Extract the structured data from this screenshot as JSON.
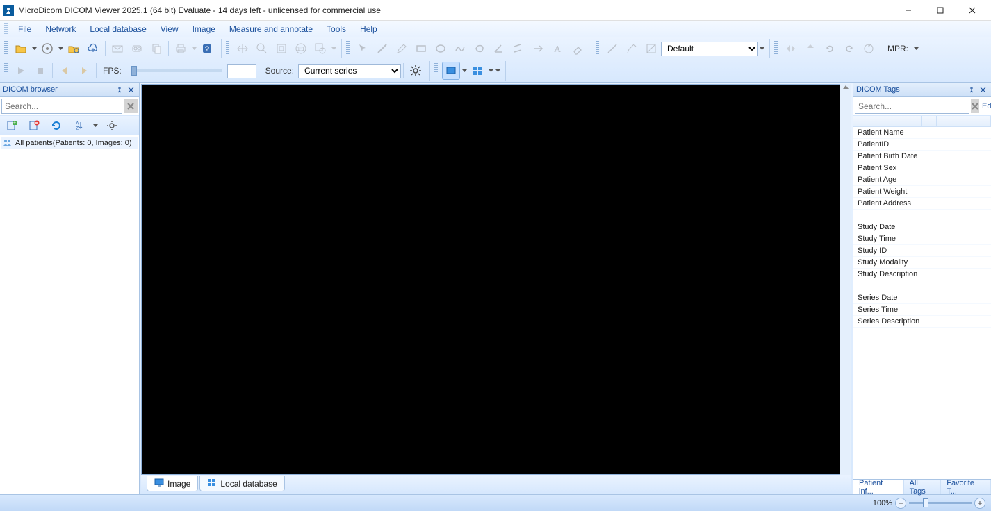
{
  "window": {
    "title": "MicroDicom DICOM Viewer 2025.1 (64 bit) Evaluate - 14 days left - unlicensed for commercial use"
  },
  "menu": [
    "File",
    "Network",
    "Local database",
    "View",
    "Image",
    "Measure and annotate",
    "Tools",
    "Help"
  ],
  "toolbar1": {
    "preset_select": "Default",
    "mpr_label": "MPR:"
  },
  "toolbar2": {
    "fps_label": "FPS:",
    "source_label": "Source:",
    "source_value": "Current series"
  },
  "left_panel": {
    "title": "DICOM browser",
    "search_placeholder": "Search...",
    "tree_root": "All patients(Patients: 0, Images: 0)"
  },
  "right_panel": {
    "title": "DICOM Tags",
    "search_placeholder": "Search...",
    "edit_label": "Edit",
    "tags": [
      "Patient Name",
      "PatientID",
      "Patient Birth Date",
      "Patient Sex",
      "Patient Age",
      "Patient Weight",
      "Patient Address",
      "",
      "Study Date",
      "Study Time",
      "Study ID",
      "Study Modality",
      "Study Description",
      "",
      "Series Date",
      "Series Time",
      "Series Description"
    ],
    "tabs": [
      "Patient inf...",
      "All Tags",
      "Favorite T..."
    ]
  },
  "viewer": {
    "tabs": [
      {
        "label": "Image",
        "active": true
      },
      {
        "label": "Local database",
        "active": false
      }
    ]
  },
  "statusbar": {
    "zoom": "100%"
  }
}
